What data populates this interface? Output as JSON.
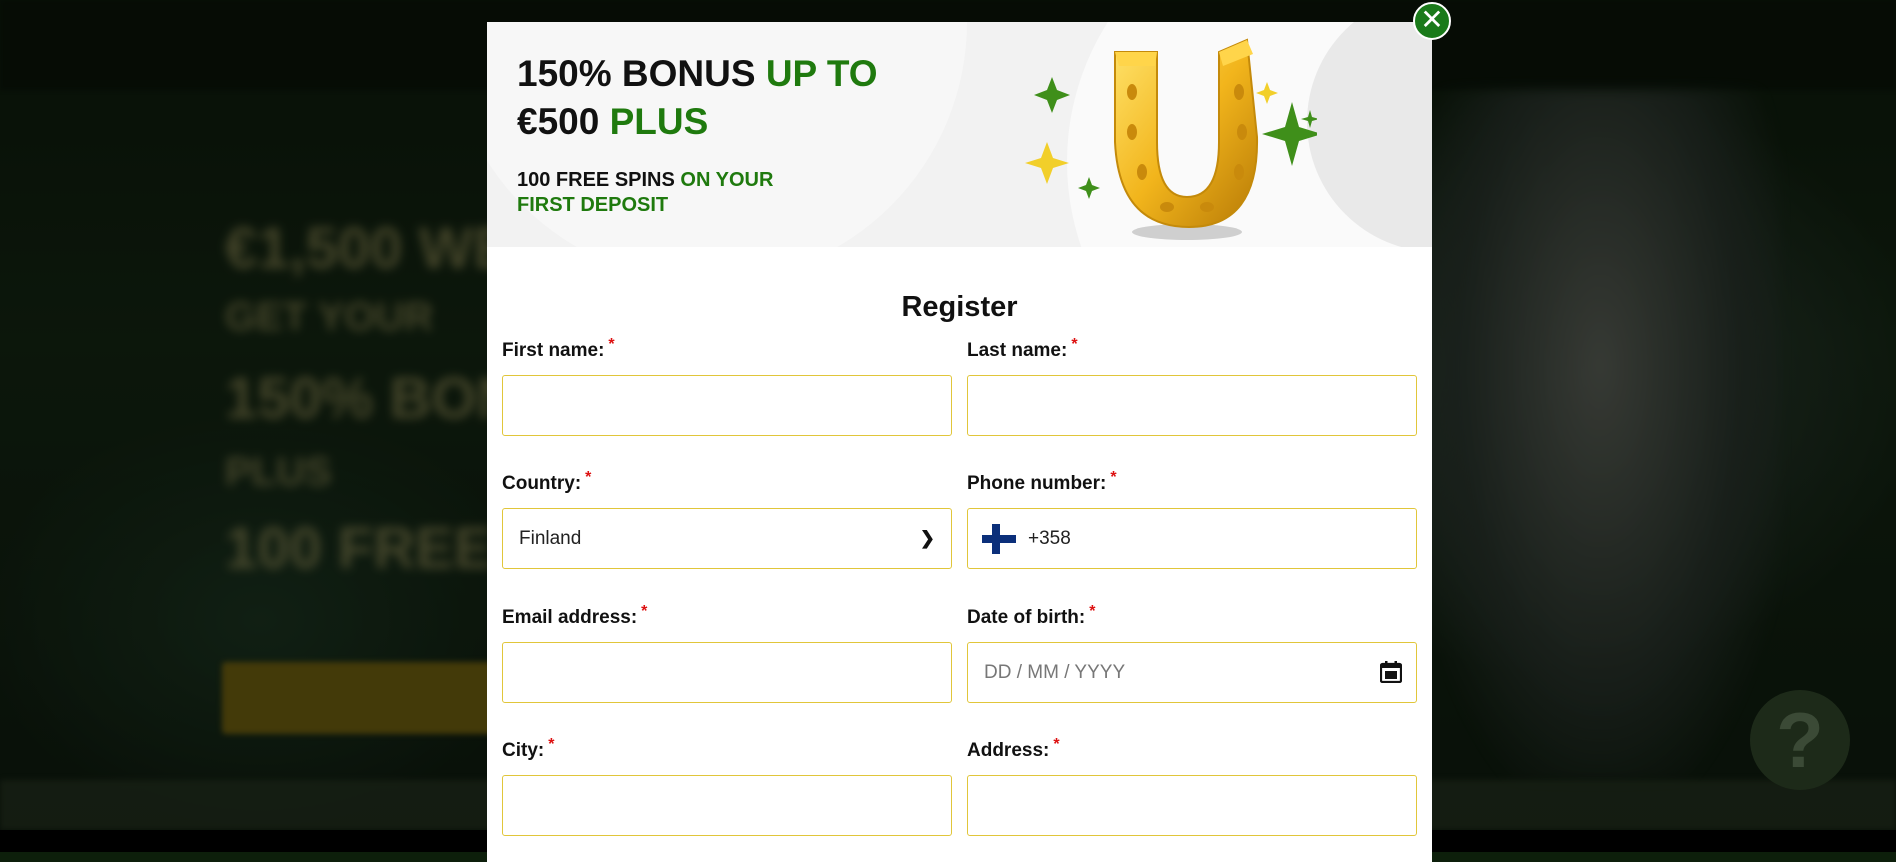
{
  "banner": {
    "line1_a": "150% BONUS ",
    "line1_b": "UP TO",
    "line2_a": "€500 ",
    "line2_b": "PLUS",
    "sub_a": "100 FREE SPINS ",
    "sub_b": "ON YOUR",
    "sub_c": "FIRST DEPOSIT"
  },
  "form": {
    "title": "Register",
    "required_mark": "*",
    "first_name": {
      "label": "First name:",
      "value": ""
    },
    "last_name": {
      "label": "Last name:",
      "value": ""
    },
    "country": {
      "label": "Country:",
      "value": "Finland"
    },
    "phone": {
      "label": "Phone number:",
      "value": "+358",
      "flag": "finland-flag"
    },
    "email": {
      "label": "Email address:",
      "value": ""
    },
    "dob": {
      "label": "Date of birth:",
      "placeholder": "DD / MM / YYYY"
    },
    "city": {
      "label": "City:",
      "value": ""
    },
    "address": {
      "label": "Address:",
      "value": ""
    }
  },
  "close_icon": "close-icon",
  "help_icon": "?",
  "colors": {
    "accent_green": "#1f7a0e",
    "input_border": "#e1c63a",
    "required": "#dd1111",
    "close_bg": "#1a7a1a"
  }
}
